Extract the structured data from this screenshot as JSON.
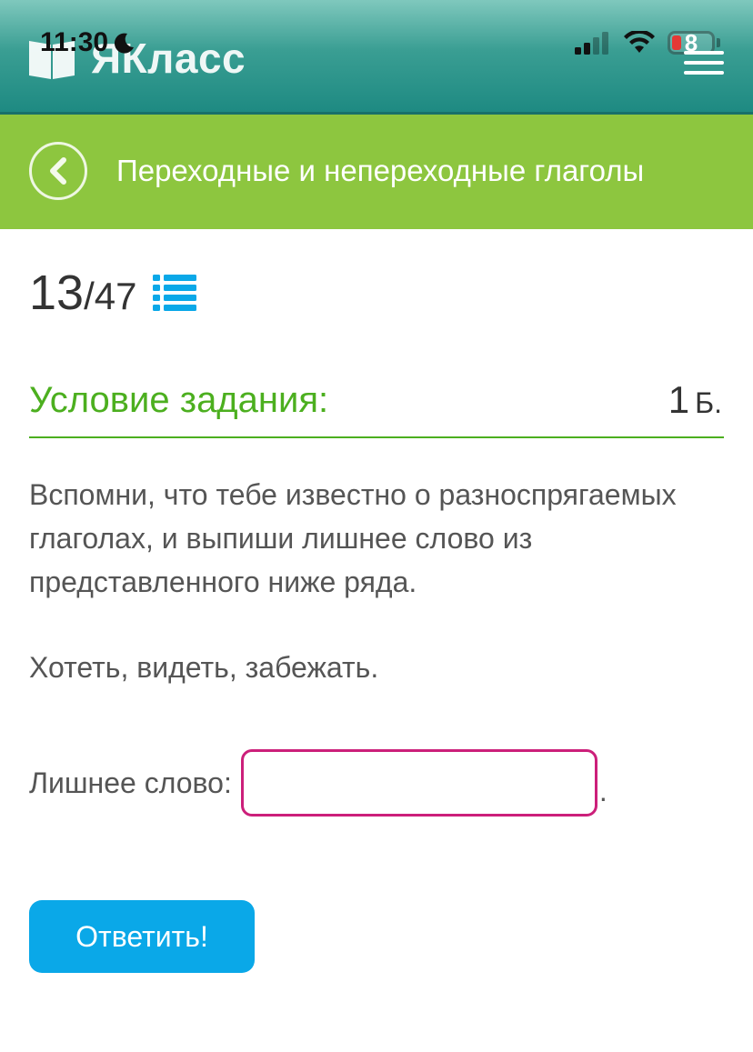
{
  "status": {
    "time": "11:30",
    "battery": "8"
  },
  "brand": {
    "name": "ЯКласс"
  },
  "titlebar": {
    "title": "Переходные и непереходные глаголы"
  },
  "progress": {
    "current": "13",
    "separator": "/",
    "total": "47"
  },
  "section": {
    "title": "Условие задания:",
    "points_value": "1",
    "points_unit": "Б."
  },
  "task": {
    "instruction": "Вспомни, что тебе известно о разноспрягаемых глаголах, и выпиши лишнее слово из представленного ниже ряда.",
    "words": "Хотеть, видеть, забежать.",
    "answer_label": "Лишнее слово:",
    "answer_value": "",
    "answer_suffix": "."
  },
  "actions": {
    "submit": "Ответить!"
  },
  "colors": {
    "header_teal": "#1e8a82",
    "title_green": "#8dc63f",
    "section_green": "#4caf1f",
    "input_border": "#cc1f7a",
    "button_blue": "#0aa8e8"
  }
}
